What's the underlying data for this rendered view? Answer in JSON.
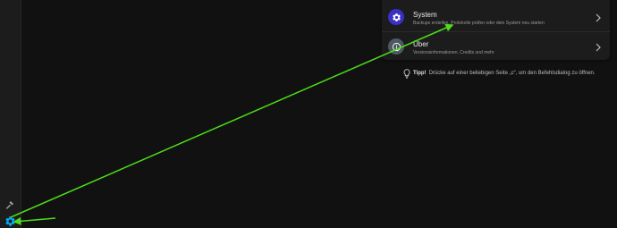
{
  "sidebar": {
    "tools_icon": "hammer-icon",
    "settings_icon": "gear-icon"
  },
  "settings_menu": {
    "items": [
      {
        "title": "System",
        "subtitle": "Backups erstellen, Protokolle prüfen oder dein System neu starten",
        "icon": "gear-icon",
        "icon_color": "#3b2fc4"
      },
      {
        "title": "Über",
        "subtitle": "Versionsinformationen, Credits und mehr",
        "icon": "info-icon",
        "icon_color": "#4e5a62"
      }
    ]
  },
  "tip": {
    "label": "Tipp!",
    "text": "Drücke auf einer beliebigen Seite „c“, um den Befehlsdialog zu öffnen.",
    "icon": "lightbulb-icon"
  },
  "colors": {
    "background": "#111111",
    "sidebar": "#1c1c1c",
    "accent": "#03a9f4",
    "annotation": "#4cdc1a"
  }
}
